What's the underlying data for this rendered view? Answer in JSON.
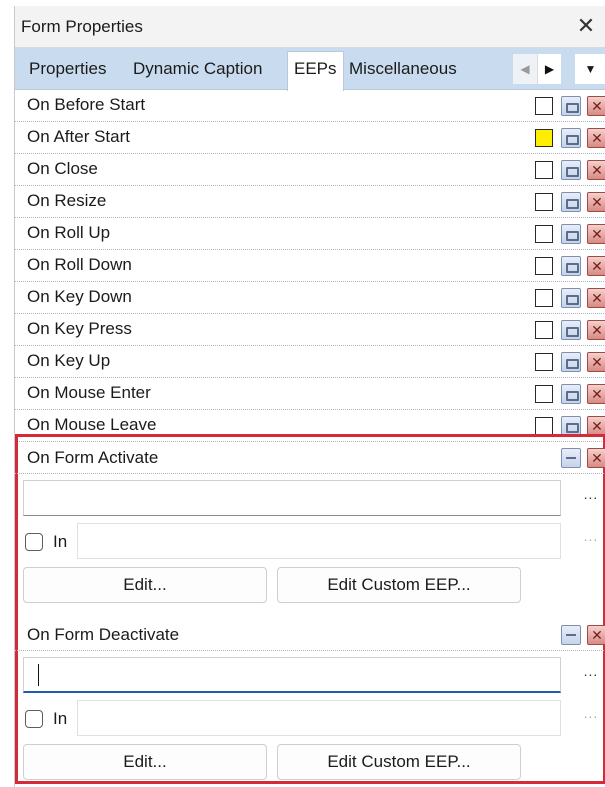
{
  "window": {
    "title": "Form Properties",
    "close_glyph": "✕"
  },
  "tabs": [
    {
      "label": "Properties",
      "active": false
    },
    {
      "label": "Dynamic Caption",
      "active": false
    },
    {
      "label": "EEPs",
      "active": true
    },
    {
      "label": "Miscellaneous",
      "active": false
    }
  ],
  "tab_nav": {
    "left_glyph": "◀",
    "right_glyph": "▶",
    "menu_glyph": "▼"
  },
  "events": [
    {
      "label": "On Before Start",
      "marked": false
    },
    {
      "label": "On After Start",
      "marked": true
    },
    {
      "label": "On Close",
      "marked": false
    },
    {
      "label": "On Resize",
      "marked": false
    },
    {
      "label": "On Roll Up",
      "marked": false
    },
    {
      "label": "On Roll Down",
      "marked": false
    },
    {
      "label": "On Key Down",
      "marked": false
    },
    {
      "label": "On Key Press",
      "marked": false
    },
    {
      "label": "On Key Up",
      "marked": false
    },
    {
      "label": "On Mouse Enter",
      "marked": false
    },
    {
      "label": "On Mouse Leave",
      "marked": false
    }
  ],
  "expanded": [
    {
      "label": "On Form Activate",
      "code_value": "",
      "in_label": "In",
      "in_value": "",
      "edit_label": "Edit...",
      "custom_label": "Edit Custom EEP...",
      "dots": "...",
      "focused": false
    },
    {
      "label": "On Form Deactivate",
      "code_value": "",
      "in_label": "In",
      "in_value": "",
      "edit_label": "Edit...",
      "custom_label": "Edit Custom EEP...",
      "dots": "...",
      "focused": true
    }
  ],
  "colors": {
    "highlight_border": "#d42a3a",
    "marked_checkbox": "#ffee00",
    "tab_strip": "#c9dcef"
  }
}
